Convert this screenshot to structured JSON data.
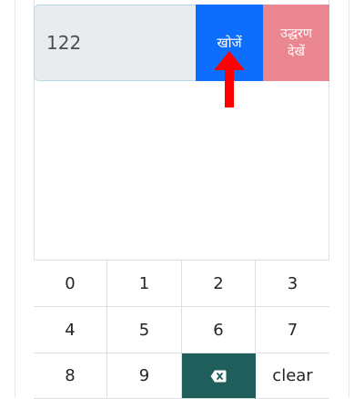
{
  "search": {
    "value": "122",
    "button_label": "खोजें",
    "quotes_line1": "उद्धरण",
    "quotes_line2": "देखें"
  },
  "keypad": {
    "keys": [
      "0",
      "1",
      "2",
      "3",
      "4",
      "5",
      "6",
      "7",
      "8",
      "9"
    ],
    "clear_label": "clear",
    "backspace_icon": "backspace-icon"
  },
  "colors": {
    "search_button": "#0d6efd",
    "quotes_button": "#ea868f",
    "backspace_key": "#1f5e5b",
    "input_background": "#e9ecef",
    "arrow": "#ff0000"
  }
}
